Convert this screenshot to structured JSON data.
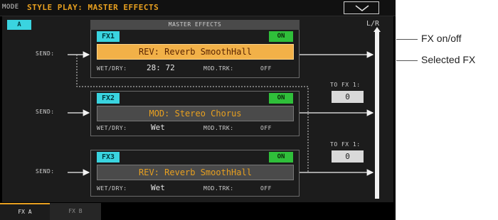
{
  "header": {
    "mode_label": "MODE",
    "title": "STYLE PLAY: MASTER EFFECTS"
  },
  "set_button": {
    "label": "A"
  },
  "master": {
    "label": "MASTER EFFECTS",
    "lr_label": "L/R"
  },
  "fx": [
    {
      "name": "FX1",
      "on_label": "ON",
      "type": "REV: Reverb SmoothHall",
      "selected": true,
      "send_label": "SEND:",
      "wetdry_label": "WET/DRY:",
      "wetdry_value": "28: 72",
      "modtrk_label": "MOD.TRK:",
      "modtrk_value": "OFF"
    },
    {
      "name": "FX2",
      "on_label": "ON",
      "type": "MOD: Stereo Chorus",
      "selected": false,
      "send_label": "SEND:",
      "wetdry_label": "WET/DRY:",
      "wetdry_value": "Wet",
      "modtrk_label": "MOD.TRK:",
      "modtrk_value": "OFF"
    },
    {
      "name": "FX3",
      "on_label": "ON",
      "type": "REV: Reverb SmoothHall",
      "selected": false,
      "send_label": "SEND:",
      "wetdry_label": "WET/DRY:",
      "wetdry_value": "Wet",
      "modtrk_label": "MOD.TRK:",
      "modtrk_value": "OFF"
    }
  ],
  "to_fx": [
    {
      "label": "TO FX 1:",
      "value": "0"
    },
    {
      "label": "TO FX 1:",
      "value": "0"
    }
  ],
  "tabs": [
    {
      "label": "FX A"
    },
    {
      "label": "FX B"
    }
  ],
  "callouts": {
    "fx_on_off": "FX on/off",
    "selected_fx": "Selected FX"
  },
  "colors": {
    "accent_orange": "#e8a020",
    "cyan": "#3ad4e0",
    "on_green": "#2fbf3a",
    "selected_fill": "#f2b148"
  }
}
